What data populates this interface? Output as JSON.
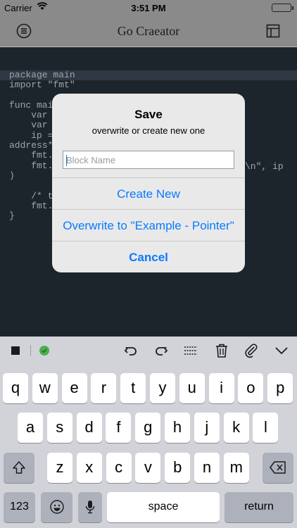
{
  "status_bar": {
    "carrier": "Carrier",
    "time": "3:51 PM"
  },
  "nav_bar": {
    "title": "Go Craeator",
    "left_icon": "menu-circle-icon",
    "right_icon": "layout-icon"
  },
  "code_lines": [
    {
      "text": "package main",
      "highlight": true
    },
    {
      "text": "import \"fmt\"",
      "highlight": false
    },
    {
      "text": "",
      "highlight": false
    },
    {
      "text": "func mai",
      "highlight": false
    },
    {
      "text": "    var",
      "highlight": false
    },
    {
      "text": "    var",
      "highlight": false
    },
    {
      "text": "    ip =",
      "highlight": false
    },
    {
      "text": "address*",
      "highlight": false
    },
    {
      "text": "    fmt.",
      "highlight": false
    },
    {
      "text": "    fmt.",
      "highlight": false
    },
    {
      "text": ")",
      "highlight": false
    },
    {
      "text": "",
      "highlight": false
    },
    {
      "text": "    /* t",
      "highlight": false
    },
    {
      "text": "    fmt.",
      "highlight": false
    },
    {
      "text": "}",
      "highlight": false
    }
  ],
  "code_right_fragment": "\\n\", ip",
  "alert": {
    "title": "Save",
    "message": "overwrite or create new one",
    "input_placeholder": "Block Name",
    "buttons": [
      "Create New",
      "Overwrite to \"Example - Pointer\"",
      "Cancel"
    ]
  },
  "toolbar": {
    "icons": [
      "stop-icon",
      "status-check-icon",
      "undo-icon",
      "redo-icon",
      "indent-icon",
      "trash-icon",
      "attach-icon",
      "dismiss-keyboard-icon"
    ]
  },
  "keyboard": {
    "row1": [
      "q",
      "w",
      "e",
      "r",
      "t",
      "y",
      "u",
      "i",
      "o",
      "p"
    ],
    "row2": [
      "a",
      "s",
      "d",
      "f",
      "g",
      "h",
      "j",
      "k",
      "l"
    ],
    "row3": [
      "z",
      "x",
      "c",
      "v",
      "b",
      "n",
      "m"
    ],
    "numbers_key": "123",
    "space_key": "space",
    "return_key": "return",
    "shift_icon": "shift-icon",
    "delete_icon": "backspace-icon",
    "emoji_icon": "emoji-icon",
    "mic_icon": "microphone-icon"
  },
  "colors": {
    "accent": "#0a7aff",
    "editor_bg": "#1d252c",
    "nav_bg": "#8a8a8a",
    "check_green": "#4cae4f"
  }
}
